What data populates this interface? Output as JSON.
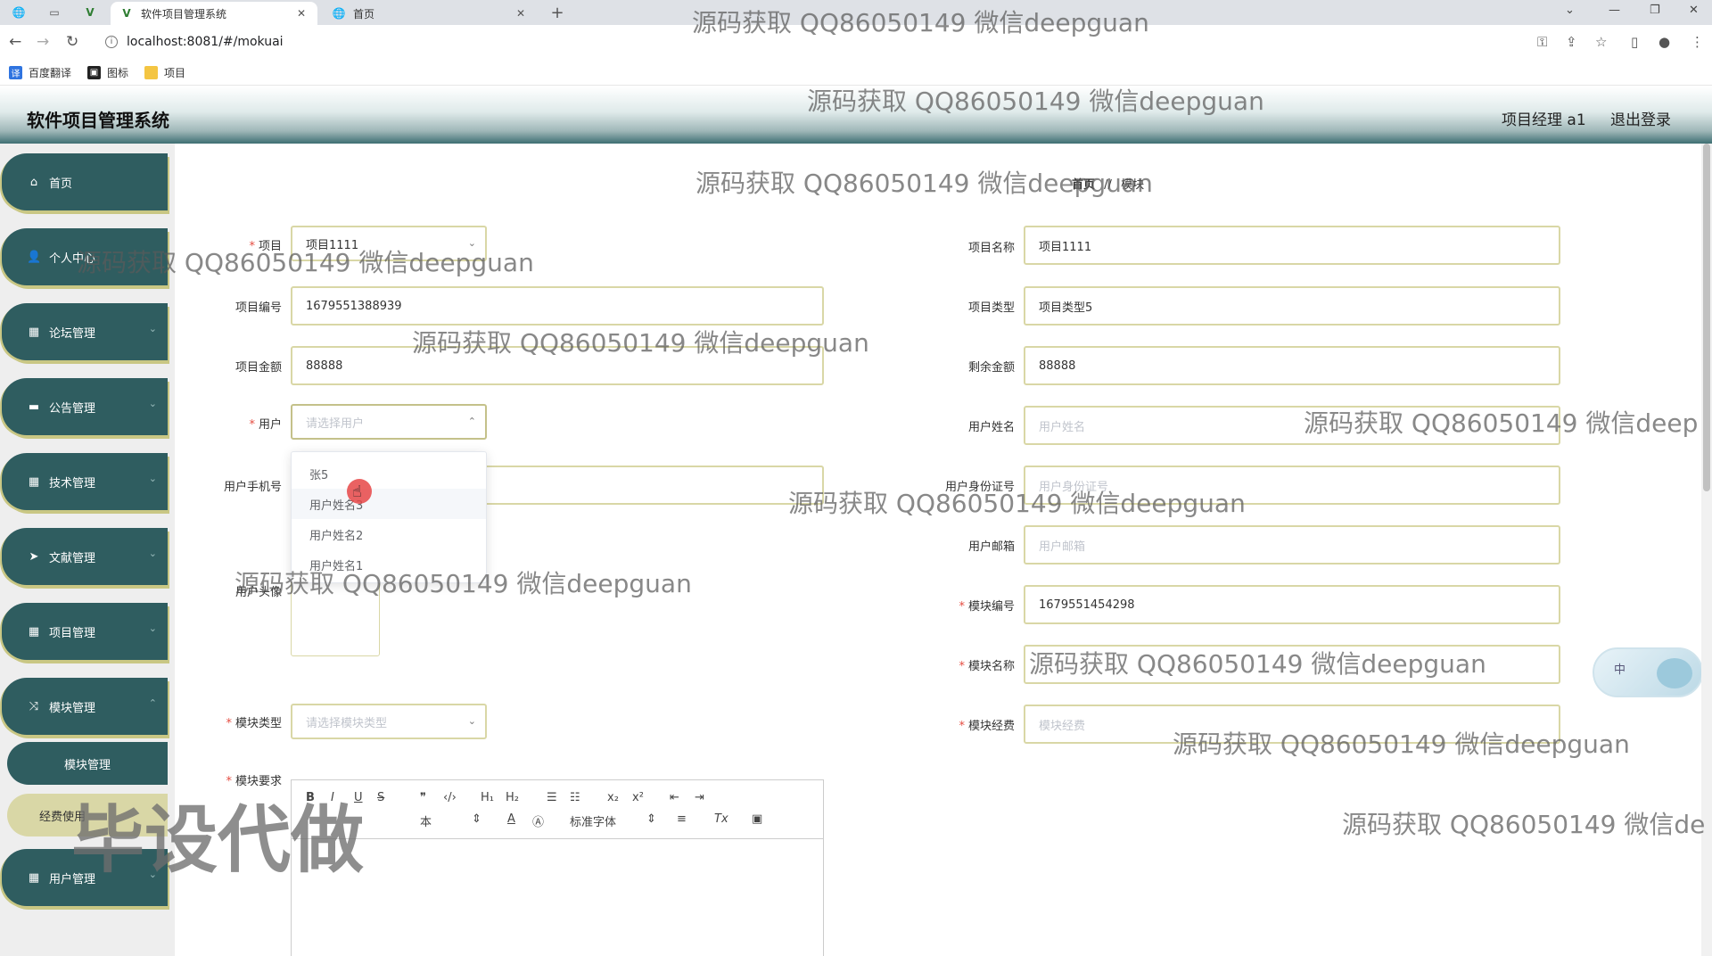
{
  "browser": {
    "tabs": [
      {
        "title": "软件项目管理系统",
        "active": true
      },
      {
        "title": "首页",
        "active": false
      }
    ],
    "url": "localhost:8081/#/mokuai",
    "bookmarks": [
      "百度翻译",
      "图标",
      "项目"
    ],
    "icons": {
      "back": "←",
      "forward": "→",
      "reload": "↻",
      "newtab": "+",
      "close": "✕"
    }
  },
  "header": {
    "title": "软件项目管理系统",
    "user": "项目经理 a1",
    "logout": "退出登录"
  },
  "sidebar": {
    "items": [
      {
        "label": "首页",
        "icon": "home-icon"
      },
      {
        "label": "个人中心",
        "icon": "user-icon"
      },
      {
        "label": "论坛管理",
        "icon": "grid-icon"
      },
      {
        "label": "公告管理",
        "icon": "monitor-icon"
      },
      {
        "label": "技术管理",
        "icon": "grid-icon"
      },
      {
        "label": "文献管理",
        "icon": "send-icon"
      },
      {
        "label": "项目管理",
        "icon": "grid-icon"
      },
      {
        "label": "模块管理",
        "icon": "shuffle-icon"
      },
      {
        "label": "用户管理",
        "icon": "grid-icon"
      }
    ],
    "sub_items": [
      "模块管理",
      "经费使用"
    ]
  },
  "breadcrumb": {
    "home": "首页",
    "sep": "//",
    "current": "模块"
  },
  "form": {
    "left": {
      "project_label": "项目",
      "project_value": "项目1111",
      "code_label": "项目编号",
      "code_value": "1679551388939",
      "amount_label": "项目金额",
      "amount_value": "88888",
      "user_label": "用户",
      "user_placeholder": "请选择用户",
      "phone_label": "用户手机号",
      "avatar_label": "用户头像",
      "module_type_label": "模块类型",
      "module_type_placeholder": "请选择模块类型",
      "module_req_label": "模块要求"
    },
    "right": {
      "project_name_label": "项目名称",
      "project_name_value": "项目1111",
      "project_type_label": "项目类型",
      "project_type_value": "项目类型5",
      "remain_label": "剩余金额",
      "remain_value": "88888",
      "user_name_label": "用户姓名",
      "user_name_placeholder": "用户姓名",
      "idcard_label": "用户身份证号",
      "idcard_placeholder": "用户身份证号",
      "email_label": "用户邮箱",
      "email_placeholder": "用户邮箱",
      "module_code_label": "模块编号",
      "module_code_value": "1679551454298",
      "module_name_label": "模块名称",
      "module_fee_label": "模块经费",
      "module_fee_placeholder": "模块经费"
    },
    "user_options": [
      "张5",
      "用户姓名3",
      "用户姓名2",
      "用户姓名1"
    ]
  },
  "editor": {
    "size_label": "本",
    "font_label": "标准字体"
  },
  "widget": {
    "label": "中"
  },
  "watermarks": {
    "text": "源码获取 QQ86050149 微信deepguan",
    "text_cut1": "源码获取 QQ86050149 微信deep",
    "text_cut2": "源码获取 QQ86050149 微信de",
    "big": "毕设代做"
  },
  "colors": {
    "sidebar_dark": "#2f5d60",
    "accent_olive": "#d9d7a6",
    "required": "#e54d42"
  }
}
